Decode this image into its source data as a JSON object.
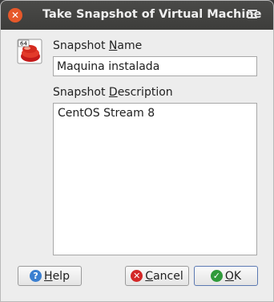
{
  "window": {
    "title": "Take Snapshot of Virtual Machine",
    "close_glyph": "✕",
    "menu_icon": "hamburger-menu-icon"
  },
  "vm_icon": {
    "os_badge": "64"
  },
  "snapshot_name": {
    "label_prefix": "Snapshot ",
    "label_mnemonic": "N",
    "label_suffix": "ame",
    "value": "Maquina instalada"
  },
  "snapshot_description": {
    "label_prefix": "Snapshot ",
    "label_mnemonic": "D",
    "label_suffix": "escription",
    "value": "CentOS Stream 8"
  },
  "buttons": {
    "help": {
      "mnemonic": "H",
      "rest": "elp",
      "icon": "?"
    },
    "cancel": {
      "mnemonic": "C",
      "rest": "ancel",
      "icon": "✕"
    },
    "ok": {
      "mnemonic": "O",
      "rest": "K",
      "icon": "✓"
    }
  },
  "colors": {
    "titlebar": "#3d3d3b",
    "close_button": "#e6582a",
    "help_icon": "#3b7fd0",
    "cancel_icon": "#d32727",
    "ok_icon": "#2f9a3a"
  }
}
